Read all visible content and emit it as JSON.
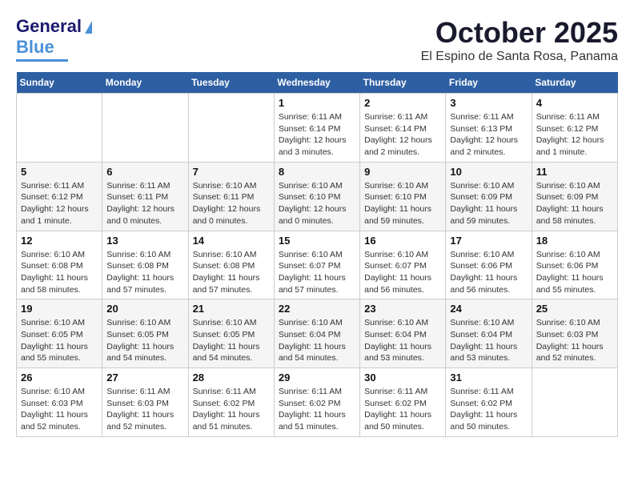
{
  "logo": {
    "line1": "General",
    "line2": "Blue"
  },
  "header": {
    "month": "October 2025",
    "location": "El Espino de Santa Rosa, Panama"
  },
  "weekdays": [
    "Sunday",
    "Monday",
    "Tuesday",
    "Wednesday",
    "Thursday",
    "Friday",
    "Saturday"
  ],
  "weeks": [
    [
      {
        "day": "",
        "info": ""
      },
      {
        "day": "",
        "info": ""
      },
      {
        "day": "",
        "info": ""
      },
      {
        "day": "1",
        "info": "Sunrise: 6:11 AM\nSunset: 6:14 PM\nDaylight: 12 hours and 3 minutes."
      },
      {
        "day": "2",
        "info": "Sunrise: 6:11 AM\nSunset: 6:14 PM\nDaylight: 12 hours and 2 minutes."
      },
      {
        "day": "3",
        "info": "Sunrise: 6:11 AM\nSunset: 6:13 PM\nDaylight: 12 hours and 2 minutes."
      },
      {
        "day": "4",
        "info": "Sunrise: 6:11 AM\nSunset: 6:12 PM\nDaylight: 12 hours and 1 minute."
      }
    ],
    [
      {
        "day": "5",
        "info": "Sunrise: 6:11 AM\nSunset: 6:12 PM\nDaylight: 12 hours and 1 minute."
      },
      {
        "day": "6",
        "info": "Sunrise: 6:11 AM\nSunset: 6:11 PM\nDaylight: 12 hours and 0 minutes."
      },
      {
        "day": "7",
        "info": "Sunrise: 6:10 AM\nSunset: 6:11 PM\nDaylight: 12 hours and 0 minutes."
      },
      {
        "day": "8",
        "info": "Sunrise: 6:10 AM\nSunset: 6:10 PM\nDaylight: 12 hours and 0 minutes."
      },
      {
        "day": "9",
        "info": "Sunrise: 6:10 AM\nSunset: 6:10 PM\nDaylight: 11 hours and 59 minutes."
      },
      {
        "day": "10",
        "info": "Sunrise: 6:10 AM\nSunset: 6:09 PM\nDaylight: 11 hours and 59 minutes."
      },
      {
        "day": "11",
        "info": "Sunrise: 6:10 AM\nSunset: 6:09 PM\nDaylight: 11 hours and 58 minutes."
      }
    ],
    [
      {
        "day": "12",
        "info": "Sunrise: 6:10 AM\nSunset: 6:08 PM\nDaylight: 11 hours and 58 minutes."
      },
      {
        "day": "13",
        "info": "Sunrise: 6:10 AM\nSunset: 6:08 PM\nDaylight: 11 hours and 57 minutes."
      },
      {
        "day": "14",
        "info": "Sunrise: 6:10 AM\nSunset: 6:08 PM\nDaylight: 11 hours and 57 minutes."
      },
      {
        "day": "15",
        "info": "Sunrise: 6:10 AM\nSunset: 6:07 PM\nDaylight: 11 hours and 57 minutes."
      },
      {
        "day": "16",
        "info": "Sunrise: 6:10 AM\nSunset: 6:07 PM\nDaylight: 11 hours and 56 minutes."
      },
      {
        "day": "17",
        "info": "Sunrise: 6:10 AM\nSunset: 6:06 PM\nDaylight: 11 hours and 56 minutes."
      },
      {
        "day": "18",
        "info": "Sunrise: 6:10 AM\nSunset: 6:06 PM\nDaylight: 11 hours and 55 minutes."
      }
    ],
    [
      {
        "day": "19",
        "info": "Sunrise: 6:10 AM\nSunset: 6:05 PM\nDaylight: 11 hours and 55 minutes."
      },
      {
        "day": "20",
        "info": "Sunrise: 6:10 AM\nSunset: 6:05 PM\nDaylight: 11 hours and 54 minutes."
      },
      {
        "day": "21",
        "info": "Sunrise: 6:10 AM\nSunset: 6:05 PM\nDaylight: 11 hours and 54 minutes."
      },
      {
        "day": "22",
        "info": "Sunrise: 6:10 AM\nSunset: 6:04 PM\nDaylight: 11 hours and 54 minutes."
      },
      {
        "day": "23",
        "info": "Sunrise: 6:10 AM\nSunset: 6:04 PM\nDaylight: 11 hours and 53 minutes."
      },
      {
        "day": "24",
        "info": "Sunrise: 6:10 AM\nSunset: 6:04 PM\nDaylight: 11 hours and 53 minutes."
      },
      {
        "day": "25",
        "info": "Sunrise: 6:10 AM\nSunset: 6:03 PM\nDaylight: 11 hours and 52 minutes."
      }
    ],
    [
      {
        "day": "26",
        "info": "Sunrise: 6:10 AM\nSunset: 6:03 PM\nDaylight: 11 hours and 52 minutes."
      },
      {
        "day": "27",
        "info": "Sunrise: 6:11 AM\nSunset: 6:03 PM\nDaylight: 11 hours and 52 minutes."
      },
      {
        "day": "28",
        "info": "Sunrise: 6:11 AM\nSunset: 6:02 PM\nDaylight: 11 hours and 51 minutes."
      },
      {
        "day": "29",
        "info": "Sunrise: 6:11 AM\nSunset: 6:02 PM\nDaylight: 11 hours and 51 minutes."
      },
      {
        "day": "30",
        "info": "Sunrise: 6:11 AM\nSunset: 6:02 PM\nDaylight: 11 hours and 50 minutes."
      },
      {
        "day": "31",
        "info": "Sunrise: 6:11 AM\nSunset: 6:02 PM\nDaylight: 11 hours and 50 minutes."
      },
      {
        "day": "",
        "info": ""
      }
    ]
  ]
}
